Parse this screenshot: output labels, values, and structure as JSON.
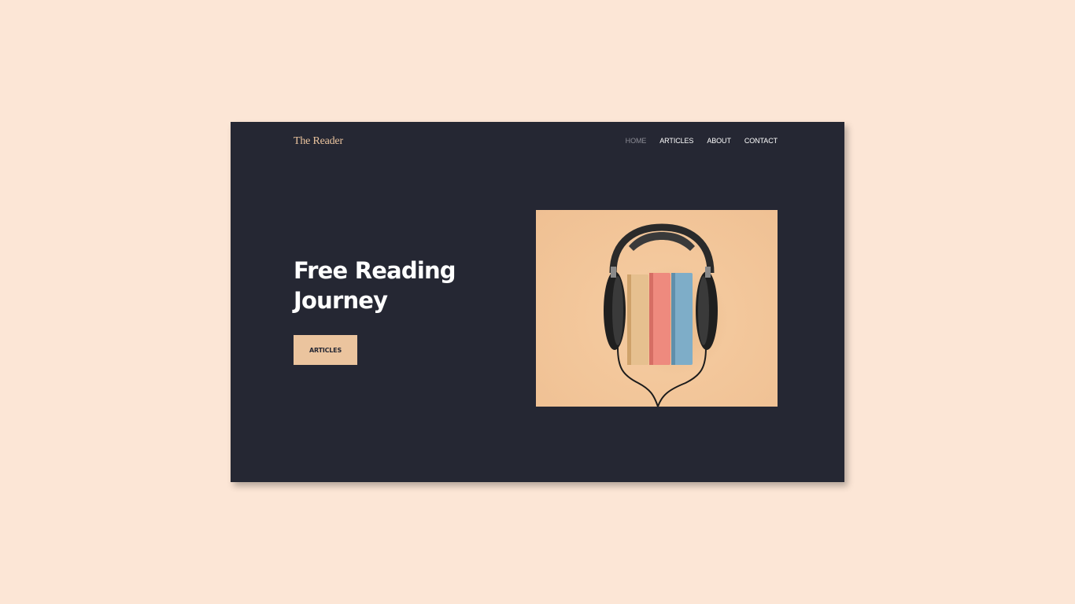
{
  "brand": "The Reader",
  "nav": {
    "home": "HOME",
    "articles": "ARTICLES",
    "about": "ABOUT",
    "contact": "CONTACT"
  },
  "hero": {
    "title_line1": "Free Reading",
    "title_line2": "Journey",
    "cta_label": "ARTICLES",
    "image_subject": "headphones-with-books-icon"
  },
  "colors": {
    "page_bg": "#fce6d6",
    "card_bg": "#252733",
    "accent": "#ebc49e",
    "nav_active": "#8d8e97",
    "text": "#ffffff"
  }
}
